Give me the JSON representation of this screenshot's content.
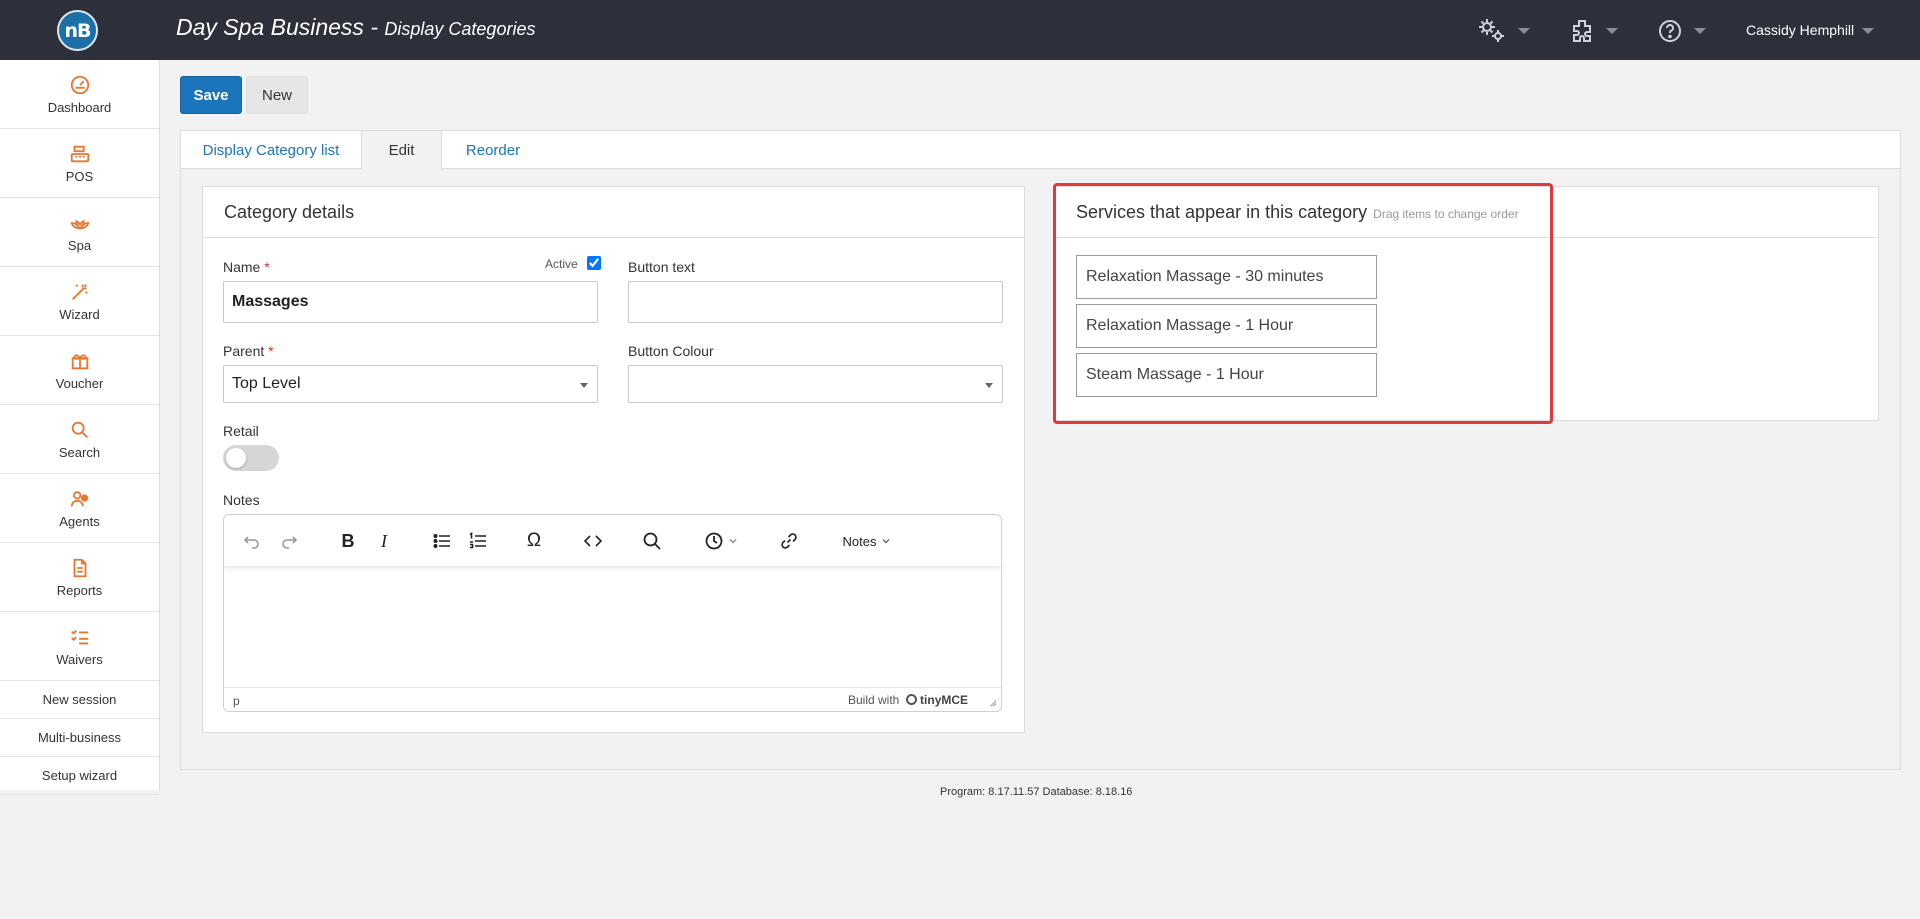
{
  "header": {
    "logo_text": "nB",
    "app_title": "Day Spa Business",
    "separator": " - ",
    "page_subtitle": "Display Categories",
    "user_name": "Cassidy Hemphill"
  },
  "sidebar": {
    "items": [
      {
        "label": "Dashboard",
        "icon": "dashboard-icon"
      },
      {
        "label": "POS",
        "icon": "cash-register-icon"
      },
      {
        "label": "Spa",
        "icon": "lotus-icon"
      },
      {
        "label": "Wizard",
        "icon": "magic-wand-icon"
      },
      {
        "label": "Voucher",
        "icon": "gift-icon"
      },
      {
        "label": "Search",
        "icon": "search-icon"
      },
      {
        "label": "Agents",
        "icon": "users-icon"
      },
      {
        "label": "Reports",
        "icon": "report-document-icon"
      },
      {
        "label": "Waivers",
        "icon": "checklist-icon"
      }
    ],
    "links": [
      "New session",
      "Multi-business",
      "Setup wizard"
    ]
  },
  "toolbar": {
    "save_label": "Save",
    "new_label": "New"
  },
  "tabs": [
    "Display Category list",
    "Edit",
    "Reorder"
  ],
  "category_details": {
    "title": "Category details",
    "name_label": "Name",
    "required_mark": "*",
    "name_value": "Massages",
    "active_label": "Active",
    "active_checked": true,
    "button_text_label": "Button text",
    "button_text_value": "",
    "parent_label": "Parent",
    "parent_value": "Top Level",
    "button_colour_label": "Button Colour",
    "button_colour_value": "",
    "retail_label": "Retail",
    "retail_on": false,
    "notes_label": "Notes",
    "editor": {
      "styles_dropdown": "Notes",
      "path": "p",
      "branding": "Build with",
      "branding_brand": "tinyMCE"
    }
  },
  "services_panel": {
    "title": "Services that appear in this category",
    "hint": "Drag items to change order",
    "items": [
      "Relaxation Massage - 30 minutes",
      "Relaxation Massage - 1 Hour",
      "Steam Massage - 1 Hour"
    ]
  },
  "footer": {
    "version": "Program: 8.17.11.57 Database: 8.18.16"
  },
  "colors": {
    "topbar": "#2d303b",
    "primary": "#1b75bb",
    "sidebar_icon": "#e8772e",
    "highlight": "#e0393e"
  }
}
